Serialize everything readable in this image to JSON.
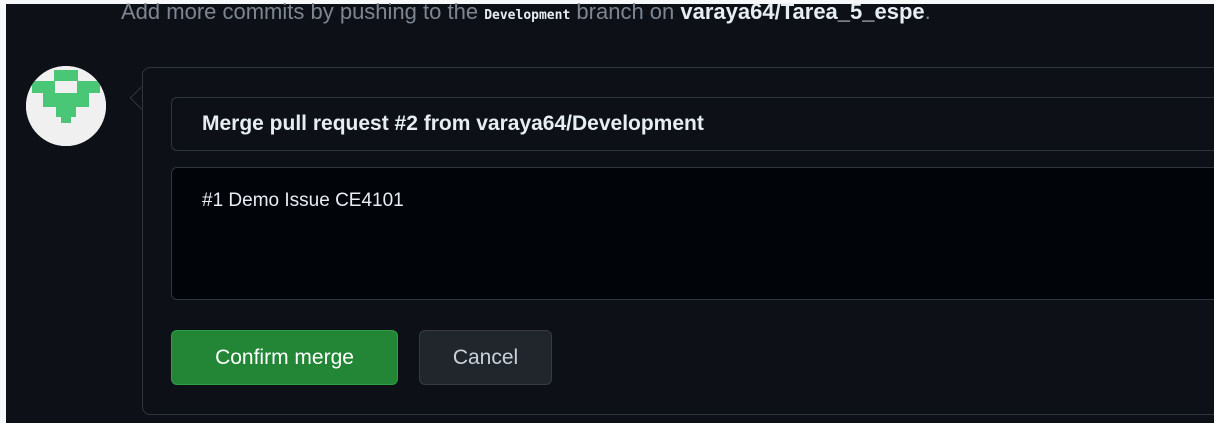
{
  "hint": {
    "prefix": "Add more commits by pushing to the",
    "branch": "Development",
    "middle": "branch on",
    "repo": "varaya64/Tarea_5_espe",
    "suffix": "."
  },
  "merge_form": {
    "commit_title": "Merge pull request #2 from varaya64/Development",
    "commit_body": "#1 Demo Issue CE4101",
    "confirm_label": "Confirm merge",
    "cancel_label": "Cancel"
  },
  "colors": {
    "background": "#0d1117",
    "confirm_button": "#238636",
    "cancel_button": "#21262d",
    "border": "#30363d",
    "muted_text": "#7d8590",
    "avatar_identicon": "#4ac776"
  },
  "icons": {
    "avatar": "identicon-avatar"
  }
}
